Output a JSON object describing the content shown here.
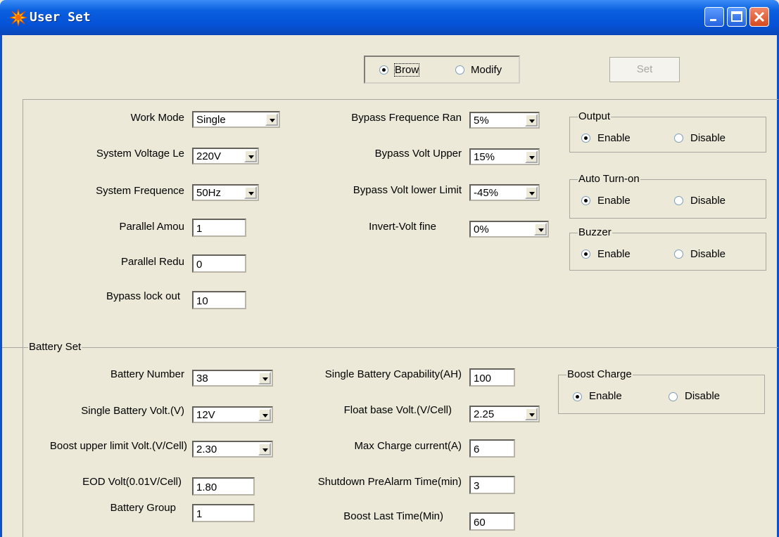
{
  "window": {
    "title": "User Set"
  },
  "mode": {
    "browse_label": "Brow",
    "modify_label": "Modify",
    "selected": "browse"
  },
  "set_button": "Set",
  "general": {
    "work_mode": {
      "label": "Work Mode",
      "value": "Single"
    },
    "system_voltage": {
      "label": "System Voltage Le",
      "value": "220V"
    },
    "system_frequence": {
      "label": "System Frequence",
      "value": "50Hz"
    },
    "parallel_amount": {
      "label": "Parallel Amou",
      "value": "1"
    },
    "parallel_redundancy": {
      "label": "Parallel Redu",
      "value": "0"
    },
    "bypass_lockout": {
      "label": "Bypass lock out",
      "value": "10"
    },
    "bypass_freq_range": {
      "label": "Bypass Frequence Ran",
      "value": "5%"
    },
    "bypass_volt_upper": {
      "label": "Bypass Volt Upper",
      "value": "15%"
    },
    "bypass_volt_lower": {
      "label": "Bypass Volt lower Limit",
      "value": "-45%"
    },
    "invert_volt_fine": {
      "label": "Invert-Volt fine",
      "value": "0%"
    }
  },
  "toggles": {
    "output": {
      "title": "Output",
      "enable": "Enable",
      "disable": "Disable"
    },
    "auto_turn_on": {
      "title": "Auto Turn-on",
      "enable": "Enable",
      "disable": "Disable"
    },
    "buzzer": {
      "title": "Buzzer",
      "enable": "Enable",
      "disable": "Disable"
    }
  },
  "battery": {
    "title": "Battery Set",
    "battery_number": {
      "label": "Battery Number",
      "value": "38"
    },
    "single_battery_volt": {
      "label": "Single Battery Volt.(V)",
      "value": "12V"
    },
    "boost_upper_limit": {
      "label": "Boost upper limit Volt.(V/Cell)",
      "value": "2.30"
    },
    "eod_volt": {
      "label": "EOD Volt(0.01V/Cell)",
      "value": "1.80"
    },
    "battery_group": {
      "label": "Battery Group",
      "value": "1"
    },
    "single_battery_capability": {
      "label": "Single Battery Capability(AH)",
      "value": "100"
    },
    "float_base_volt": {
      "label": "Float base Volt.(V/Cell)",
      "value": "2.25"
    },
    "max_charge_current": {
      "label": "Max Charge current(A)",
      "value": "6"
    },
    "shutdown_prealarm": {
      "label": "Shutdown PreAlarm Time(min)",
      "value": "3"
    },
    "boost_last_time": {
      "label": "Boost Last Time(Min)",
      "value": "60"
    },
    "boost_charge": {
      "title": "Boost Charge",
      "enable": "Enable",
      "disable": "Disable"
    }
  },
  "colors": {
    "titlebar": "#0552d6",
    "face": "#ece9d8"
  }
}
